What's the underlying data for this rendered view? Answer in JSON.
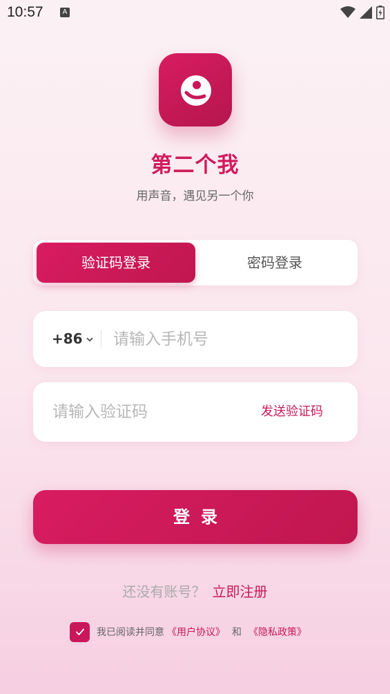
{
  "status_bar": {
    "time": "10:57",
    "notification_letter": "A"
  },
  "app": {
    "name": "第二个我",
    "slogan": "用声音，遇见另一个你"
  },
  "tabs": [
    {
      "label": "验证码登录",
      "active": true
    },
    {
      "label": "密码登录",
      "active": false
    }
  ],
  "phone": {
    "country_code": "+86",
    "placeholder": "请输入手机号",
    "value": ""
  },
  "code": {
    "placeholder": "请输入验证码",
    "value": "",
    "send_label": "发送验证码"
  },
  "login_button": {
    "label": "登录"
  },
  "register": {
    "hint": "还没有账号？",
    "link": "立即注册"
  },
  "agreement": {
    "checked": true,
    "prefix": "我已阅读并同意",
    "user_agreement": "《用户协议》",
    "and": "和",
    "privacy_policy": "《隐私政策》"
  },
  "colors": {
    "accent": "#d11c5c",
    "accent_dark": "#c0174f"
  }
}
